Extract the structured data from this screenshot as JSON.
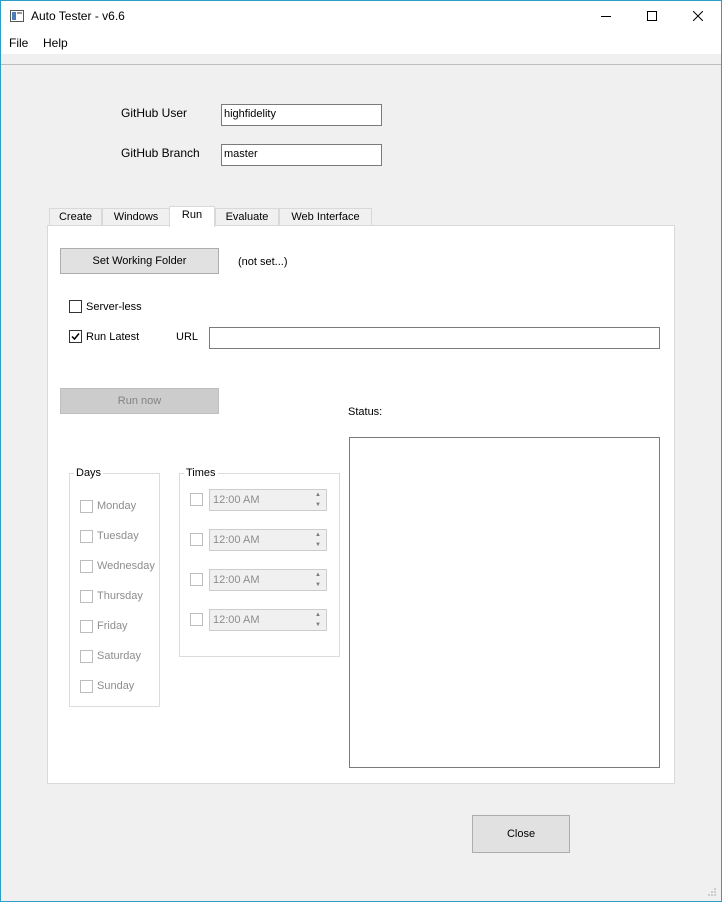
{
  "window": {
    "title": "Auto Tester - v6.6"
  },
  "menu": {
    "items": [
      "File",
      "Help"
    ]
  },
  "github": {
    "user_label": "GitHub User",
    "user_value": "highfidelity",
    "branch_label": "GitHub Branch",
    "branch_value": "master"
  },
  "tabs": [
    "Create",
    "Windows",
    "Run",
    "Evaluate",
    "Web Interface"
  ],
  "active_tab": "Run",
  "run": {
    "set_folder_label": "Set Working Folder",
    "folder_value": "(not set...)",
    "serverless_label": "Server-less",
    "serverless_checked": false,
    "run_latest_label": "Run Latest",
    "run_latest_checked": true,
    "url_label": "URL",
    "url_value": "",
    "run_now_label": "Run now",
    "status_label": "Status:",
    "days_title": "Days",
    "days": [
      "Monday",
      "Tuesday",
      "Wednesday",
      "Thursday",
      "Friday",
      "Saturday",
      "Sunday"
    ],
    "times_title": "Times",
    "times": [
      "12:00 AM",
      "12:00 AM",
      "12:00 AM",
      "12:00 AM"
    ]
  },
  "close_label": "Close",
  "colors": {
    "window_border": "#2b9fc9",
    "background": "#f0f0f0",
    "panel": "#ffffff"
  }
}
